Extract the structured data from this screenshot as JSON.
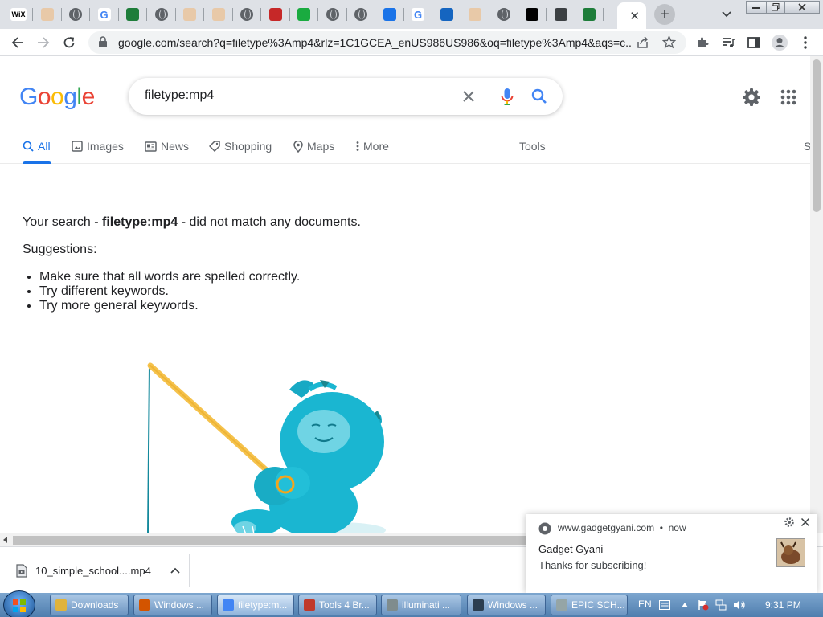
{
  "browser": {
    "tabs": [
      {
        "icon": "wix-icon",
        "label": "WiX",
        "color": "#ffffff",
        "text": "#000000"
      },
      {
        "icon": "image-icon",
        "color": "#e8c9a8"
      },
      {
        "icon": "globe-icon"
      },
      {
        "icon": "google-icon"
      },
      {
        "icon": "gear-app-icon",
        "color": "#1e7d3a"
      },
      {
        "icon": "globe-icon"
      },
      {
        "icon": "image-icon",
        "color": "#e8c9a8"
      },
      {
        "icon": "image-icon",
        "color": "#e8c9a8"
      },
      {
        "icon": "globe-icon"
      },
      {
        "icon": "red-app-icon",
        "color": "#c62828"
      },
      {
        "icon": "check-icon",
        "color": "#1aab40"
      },
      {
        "icon": "globe-icon"
      },
      {
        "icon": "globe-icon"
      },
      {
        "icon": "cloud-icon",
        "color": "#1a73e8"
      },
      {
        "icon": "google-icon"
      },
      {
        "icon": "malwarebytes-icon",
        "color": "#1565c0"
      },
      {
        "icon": "image-icon",
        "color": "#e8c9a8"
      },
      {
        "icon": "globe-icon"
      },
      {
        "icon": "plus-box-icon",
        "color": "#000000"
      },
      {
        "icon": "dashboard-icon",
        "color": "#3c4043"
      },
      {
        "icon": "gear-app-icon",
        "color": "#1e7d3a"
      }
    ],
    "active_tab_close": "✕",
    "new_tab_label": "+",
    "url": "google.com/search?q=filetype%3Amp4&rlz=1C1GCEA_enUS986US986&oq=filetype%3Amp4&aqs=c..."
  },
  "google": {
    "logo": [
      {
        "ch": "G",
        "color": "#4285f4"
      },
      {
        "ch": "o",
        "color": "#ea4335"
      },
      {
        "ch": "o",
        "color": "#fbbc05"
      },
      {
        "ch": "g",
        "color": "#4285f4"
      },
      {
        "ch": "l",
        "color": "#34a853"
      },
      {
        "ch": "e",
        "color": "#ea4335"
      }
    ],
    "query": "filetype:mp4",
    "nav": {
      "all": "All",
      "images": "Images",
      "news": "News",
      "shopping": "Shopping",
      "maps": "Maps",
      "more": "More",
      "tools": "Tools",
      "safe": "S"
    },
    "result": {
      "pre": "Your search - ",
      "term": "filetype:mp4",
      "post": " - did not match any documents.",
      "suggestions_title": "Suggestions:",
      "suggestions": [
        "Make sure that all words are spelled correctly.",
        "Try different keywords.",
        "Try more general keywords."
      ]
    },
    "accent": "#1a73e8"
  },
  "downloads": {
    "file_name": "10_simple_school....mp4"
  },
  "notification": {
    "source": "www.gadgetgyani.com",
    "time": "now",
    "title": "Gadget Gyani",
    "body": "Thanks for subscribing!"
  },
  "taskbar": {
    "items": [
      {
        "label": "Downloads",
        "color": "#e0b33c"
      },
      {
        "label": "Windows ...",
        "color": "#d35400"
      },
      {
        "label": "filetype:m...",
        "color": "#4285f4"
      },
      {
        "label": "Tools 4 Br...",
        "color": "#c0392b"
      },
      {
        "label": "illuminati ...",
        "color": "#7f8c8d"
      },
      {
        "label": "Windows ...",
        "color": "#2c3e50"
      },
      {
        "label": "EPIC SCH...",
        "color": "#95a5a6"
      }
    ],
    "lang": "EN",
    "clock": "9:31 PM"
  }
}
